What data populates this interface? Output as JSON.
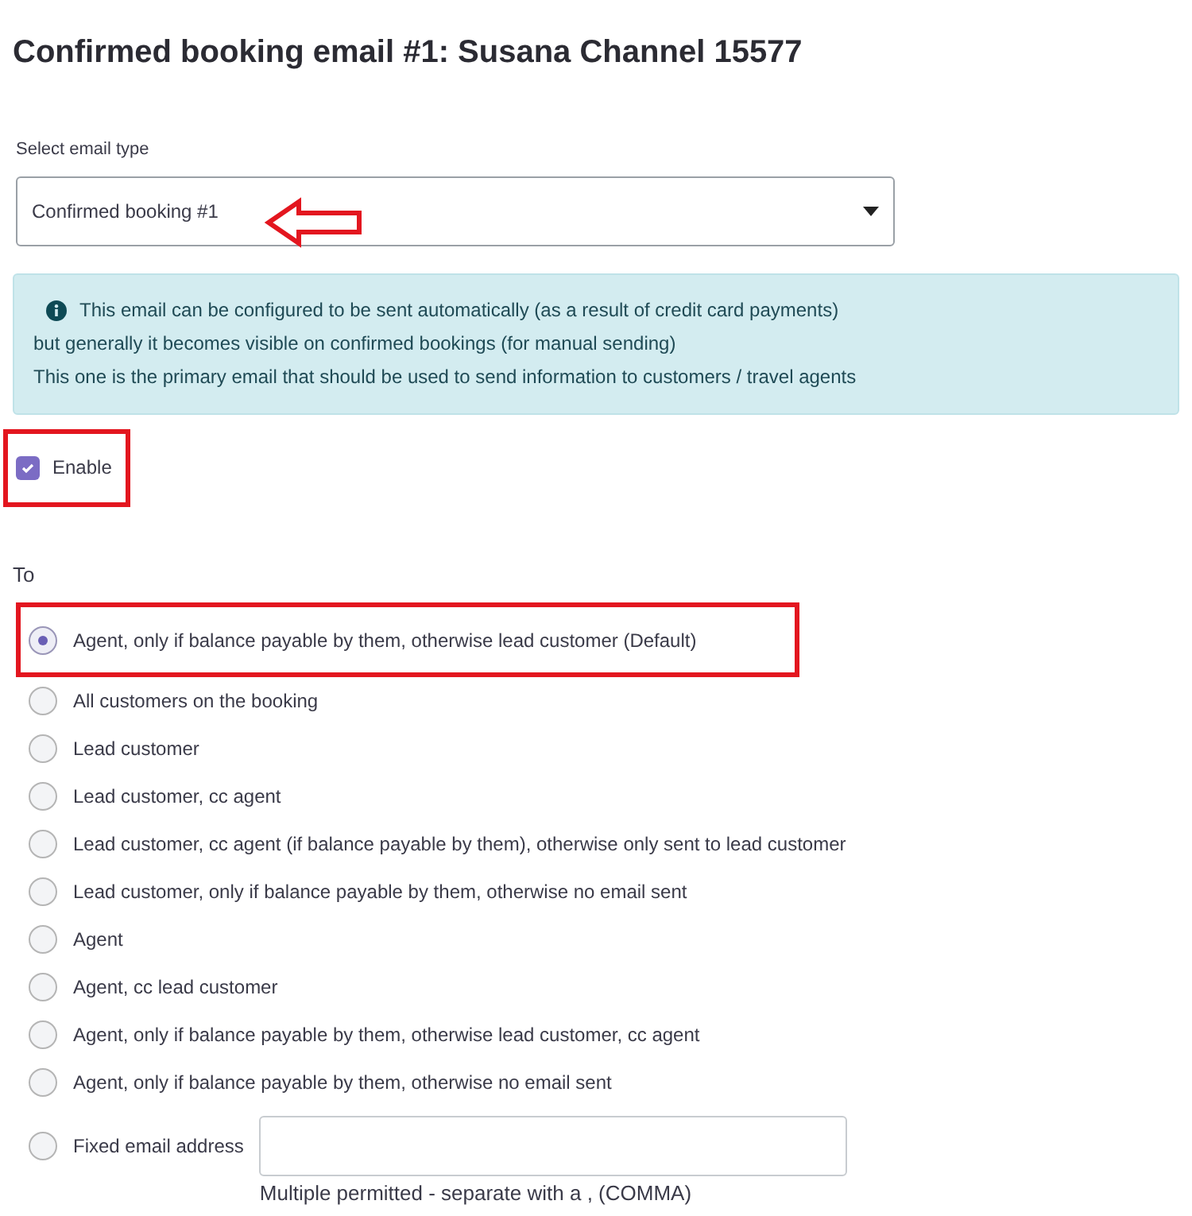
{
  "title": "Confirmed booking email #1: Susana Channel 15577",
  "email_type": {
    "label": "Select email type",
    "value": "Confirmed booking #1"
  },
  "info": {
    "lines": [
      "This email can be configured to be sent automatically (as a result of credit card payments)",
      "but generally it becomes visible on confirmed bookings (for manual sending)",
      "This one is the primary email that should be used to send information to customers / travel agents"
    ]
  },
  "enable": {
    "label": "Enable",
    "checked": true
  },
  "to": {
    "label": "To",
    "options": [
      {
        "label": "Agent, only if balance payable by them, otherwise lead customer (Default)",
        "selected": true
      },
      {
        "label": "All customers on the booking",
        "selected": false
      },
      {
        "label": "Lead customer",
        "selected": false
      },
      {
        "label": "Lead customer, cc agent",
        "selected": false
      },
      {
        "label": "Lead customer, cc agent (if balance payable by them), otherwise only sent to lead customer",
        "selected": false
      },
      {
        "label": "Lead customer, only if balance payable by them, otherwise no email sent",
        "selected": false
      },
      {
        "label": "Agent",
        "selected": false
      },
      {
        "label": "Agent, cc lead customer",
        "selected": false
      },
      {
        "label": "Agent, only if balance payable by them, otherwise lead customer, cc agent",
        "selected": false
      },
      {
        "label": "Agent, only if balance payable by them, otherwise no email sent",
        "selected": false
      }
    ],
    "fixed": {
      "label": "Fixed email address",
      "selected": false,
      "hint": "Multiple permitted - separate with a , (COMMA)"
    }
  }
}
